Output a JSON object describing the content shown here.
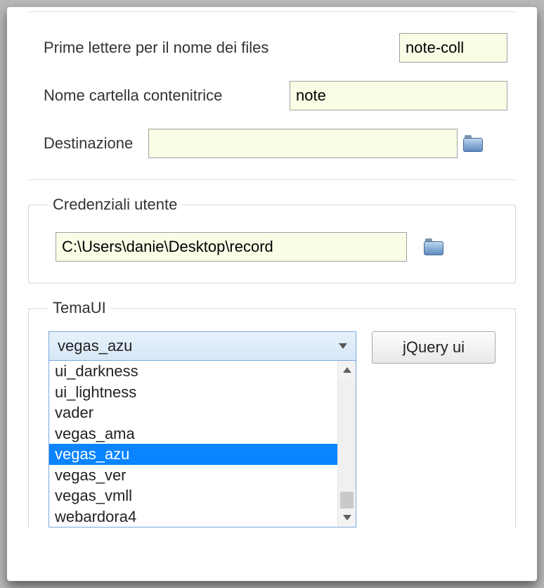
{
  "files": {
    "prefix_label": "Prime lettere per il nome dei files",
    "prefix_value": "note-coll",
    "folder_label": "Nome cartella contenitrice",
    "folder_value": "note",
    "dest_label": "Destinazione",
    "dest_value": ""
  },
  "credentials": {
    "legend": "Credenziali utente",
    "path": "C:\\Users\\danie\\Desktop\\record"
  },
  "theme": {
    "legend": "TemaUI",
    "selected": "vegas_azu",
    "options": [
      "ui_darkness",
      "ui_lightness",
      "vader",
      "vegas_ama",
      "vegas_azu",
      "vegas_ver",
      "vegas_vmll",
      "webardora4"
    ],
    "selected_index": 4,
    "jquery_button": "jQuery ui"
  }
}
